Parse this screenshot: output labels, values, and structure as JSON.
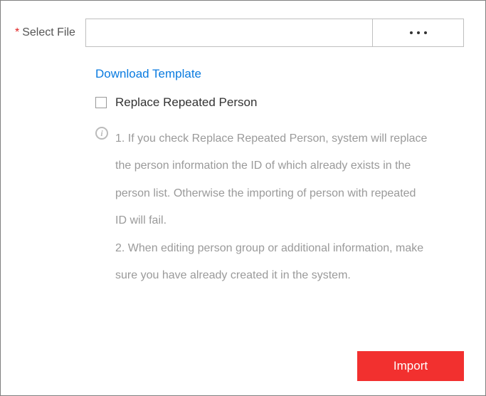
{
  "form": {
    "select_file_label": "Select File",
    "required_star": "*",
    "file_value": "",
    "browse_label": "...",
    "download_template_link": "Download Template",
    "replace_repeated_label": "Replace Repeated Person",
    "info_text": "1. If you check Replace Repeated Person, system will replace the person information the ID of which already exists in the person list. Otherwise the importing of person with repeated ID will fail.\n2. When editing person group or additional information, make sure you have already created it in the system."
  },
  "footer": {
    "import_label": "Import"
  }
}
